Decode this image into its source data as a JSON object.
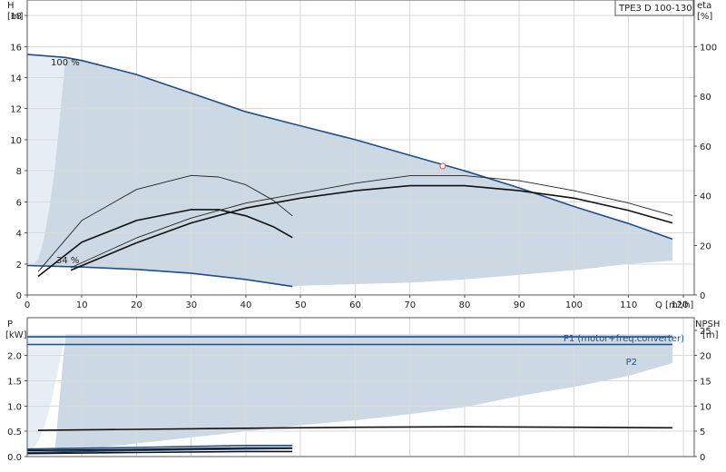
{
  "colors": {
    "area": "#ccd8e3",
    "area_light": "#e6edf4",
    "blue": "#1f4e8c",
    "black": "#111111",
    "thin": "#222222",
    "grid": "#d9d9d9",
    "duty_point": "#e05050"
  },
  "chart_data": [
    {
      "type": "line",
      "id": "head",
      "title": "TPE3 D 100-130",
      "ylabel": "H",
      "yunit": "[m]",
      "xlabel": "Q [m³/h]",
      "y2label": "eta",
      "y2unit": "[%]",
      "xlim": [
        0,
        122
      ],
      "ylim": [
        0,
        19
      ],
      "y2lim": [
        0,
        118.75
      ],
      "xticks": [
        0,
        10,
        20,
        30,
        40,
        50,
        60,
        70,
        80,
        90,
        100,
        110,
        120
      ],
      "yticks": [
        0,
        2,
        4,
        6,
        8,
        10,
        12,
        14,
        16,
        18
      ],
      "y2ticks": [
        0,
        20,
        40,
        60,
        80,
        100
      ],
      "grid": true,
      "annotations": [
        {
          "text": "100 %",
          "x": 5,
          "y": 15.3
        },
        {
          "text": "34 %",
          "x": 6,
          "y": 2.1
        }
      ],
      "duty_point": {
        "x": 76,
        "y": 8.3
      },
      "series": [
        {
          "role": "max-curve",
          "color": "blue",
          "x": [
            0,
            7,
            10,
            20,
            30,
            40,
            50,
            60,
            70,
            80,
            90,
            100,
            110,
            118
          ],
          "y": [
            15.5,
            15.3,
            15.1,
            14.2,
            13.0,
            11.8,
            10.9,
            10.0,
            9.0,
            8.0,
            6.9,
            5.7,
            4.6,
            3.6
          ]
        },
        {
          "role": "min-curve",
          "color": "blue",
          "x": [
            0,
            10,
            20,
            30,
            40,
            48.5
          ],
          "y": [
            1.9,
            1.8,
            1.65,
            1.4,
            1.0,
            0.55
          ]
        },
        {
          "role": "head-mid",
          "color": "black",
          "x": [
            2,
            10,
            20,
            30,
            35,
            40,
            45,
            48.5
          ],
          "y": [
            1.2,
            3.4,
            4.8,
            5.5,
            5.5,
            5.1,
            4.4,
            3.7
          ]
        },
        {
          "role": "head-upper-thin",
          "color": "thin",
          "x": [
            2,
            10,
            20,
            30,
            35,
            40,
            45,
            48.5
          ],
          "y": [
            1.5,
            4.8,
            6.8,
            7.7,
            7.6,
            7.1,
            6.1,
            5.1
          ]
        },
        {
          "role": "eta-main",
          "color": "black",
          "axis": "y2",
          "x": [
            8,
            20,
            30,
            40,
            50,
            60,
            70,
            80,
            90,
            100,
            110,
            118
          ],
          "y": [
            10,
            21,
            29,
            35,
            39,
            42,
            44,
            44,
            42,
            39,
            34,
            29
          ]
        },
        {
          "role": "eta-thin",
          "color": "thin",
          "axis": "y2",
          "x": [
            8,
            20,
            30,
            40,
            50,
            60,
            70,
            80,
            90,
            100,
            110,
            118
          ],
          "y": [
            11,
            23,
            31,
            37,
            41,
            45,
            48,
            48,
            46,
            42,
            37,
            32
          ]
        }
      ],
      "shaded_region": {
        "upper_x": [
          0,
          7,
          10,
          20,
          30,
          40,
          50,
          60,
          70,
          80,
          90,
          100,
          110,
          118
        ],
        "upper_y": [
          15.5,
          15.3,
          15.1,
          14.2,
          13.0,
          11.8,
          10.9,
          10.0,
          9.0,
          8.0,
          6.9,
          5.7,
          4.6,
          3.6
        ],
        "lower_x": [
          118,
          110,
          100,
          90,
          80,
          70,
          60,
          50,
          48.5,
          40,
          30,
          20,
          10,
          0
        ],
        "lower_y": [
          2.2,
          2.0,
          1.6,
          1.3,
          1.0,
          0.8,
          0.7,
          0.6,
          0.55,
          1.0,
          1.4,
          1.65,
          1.8,
          1.9
        ],
        "light_x": [
          0,
          7,
          6,
          5,
          4,
          3,
          2,
          1,
          0
        ],
        "light_y": [
          15.5,
          15.3,
          11.5,
          8.0,
          5.5,
          3.5,
          2.3,
          1.95,
          1.9
        ]
      }
    },
    {
      "type": "line",
      "id": "power",
      "ylabel": "P",
      "yunit": "[kW]",
      "y2label": "NPSH",
      "y2unit": "[m]",
      "xlim": [
        0,
        122
      ],
      "ylim": [
        0,
        2.75
      ],
      "y2lim": [
        0,
        27.5
      ],
      "yticks": [
        0,
        0.5,
        1.0,
        1.5,
        2.0
      ],
      "ytick_labels": [
        "0.0",
        "0.5",
        "1.0",
        "1.5",
        "2.0"
      ],
      "y2ticks": [
        0,
        5,
        10,
        15,
        20,
        25
      ],
      "grid": true,
      "labels": [
        {
          "text": "P1 (motor+freq.converter)",
          "color": "blue"
        },
        {
          "text": "P2",
          "color": "blue"
        }
      ],
      "series": [
        {
          "role": "P1",
          "color": "blue",
          "x": [
            0,
            118
          ],
          "y": [
            2.37,
            2.37
          ]
        },
        {
          "role": "P2",
          "color": "blue",
          "x": [
            0,
            118
          ],
          "y": [
            2.22,
            2.22
          ]
        },
        {
          "role": "NPSH",
          "color": "black",
          "axis": "y2",
          "x": [
            2,
            20,
            40,
            60,
            80,
            100,
            118
          ],
          "y": [
            5.2,
            5.4,
            5.6,
            5.8,
            5.9,
            5.8,
            5.7
          ]
        },
        {
          "role": "P1-min",
          "color": "blue",
          "x": [
            0,
            20,
            40,
            48.5
          ],
          "y": [
            0.15,
            0.18,
            0.22,
            0.22
          ]
        },
        {
          "role": "P2-min",
          "color": "blue",
          "x": [
            0,
            20,
            40,
            48.5
          ],
          "y": [
            0.08,
            0.12,
            0.15,
            0.16
          ]
        },
        {
          "role": "low-black-1",
          "color": "black",
          "x": [
            0,
            20,
            40,
            48.5
          ],
          "y": [
            0.12,
            0.14,
            0.17,
            0.17
          ]
        },
        {
          "role": "low-black-2",
          "color": "black",
          "x": [
            0,
            20,
            40,
            48.5
          ],
          "y": [
            0.06,
            0.08,
            0.1,
            0.1
          ]
        }
      ],
      "shaded_region": {
        "upper_x": [
          7,
          118
        ],
        "upper_y": [
          2.42,
          2.42
        ],
        "lower_x": [
          118,
          110,
          100,
          90,
          80,
          70,
          60,
          50,
          40,
          30,
          20,
          10,
          5
        ],
        "lower_y": [
          1.85,
          1.6,
          1.38,
          1.2,
          0.98,
          0.84,
          0.72,
          0.62,
          0.5,
          0.38,
          0.26,
          0.14,
          0.05
        ],
        "light_x": [
          0,
          7,
          6,
          5,
          4,
          3,
          2,
          1,
          0
        ],
        "light_y": [
          2.42,
          2.42,
          1.9,
          1.4,
          0.9,
          0.55,
          0.3,
          0.15,
          0.1
        ]
      }
    }
  ]
}
